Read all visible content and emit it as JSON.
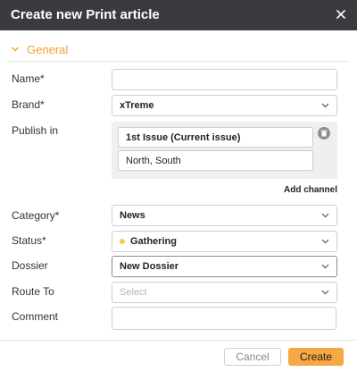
{
  "dialog": {
    "title": "Create new Print article",
    "close_icon": "close-icon"
  },
  "section": {
    "label": "General",
    "expanded": true,
    "accent_color": "#f0a030"
  },
  "fields": {
    "name": {
      "label": "Name*",
      "value": ""
    },
    "brand": {
      "label": "Brand*",
      "value": "xTreme"
    },
    "publish_in": {
      "label": "Publish in",
      "issue": "1st Issue (Current issue)",
      "editions": "North, South"
    },
    "add_channel": "Add channel",
    "category": {
      "label": "Category*",
      "value": "News"
    },
    "status": {
      "label": "Status*",
      "value": "Gathering",
      "status_color": "#f2d33d"
    },
    "dossier": {
      "label": "Dossier",
      "value": "New Dossier"
    },
    "route_to": {
      "label": "Route To",
      "placeholder": "Select"
    },
    "comment": {
      "label": "Comment",
      "value": ""
    }
  },
  "buttons": {
    "cancel": "Cancel",
    "create": "Create",
    "create_color": "#f5a844"
  }
}
